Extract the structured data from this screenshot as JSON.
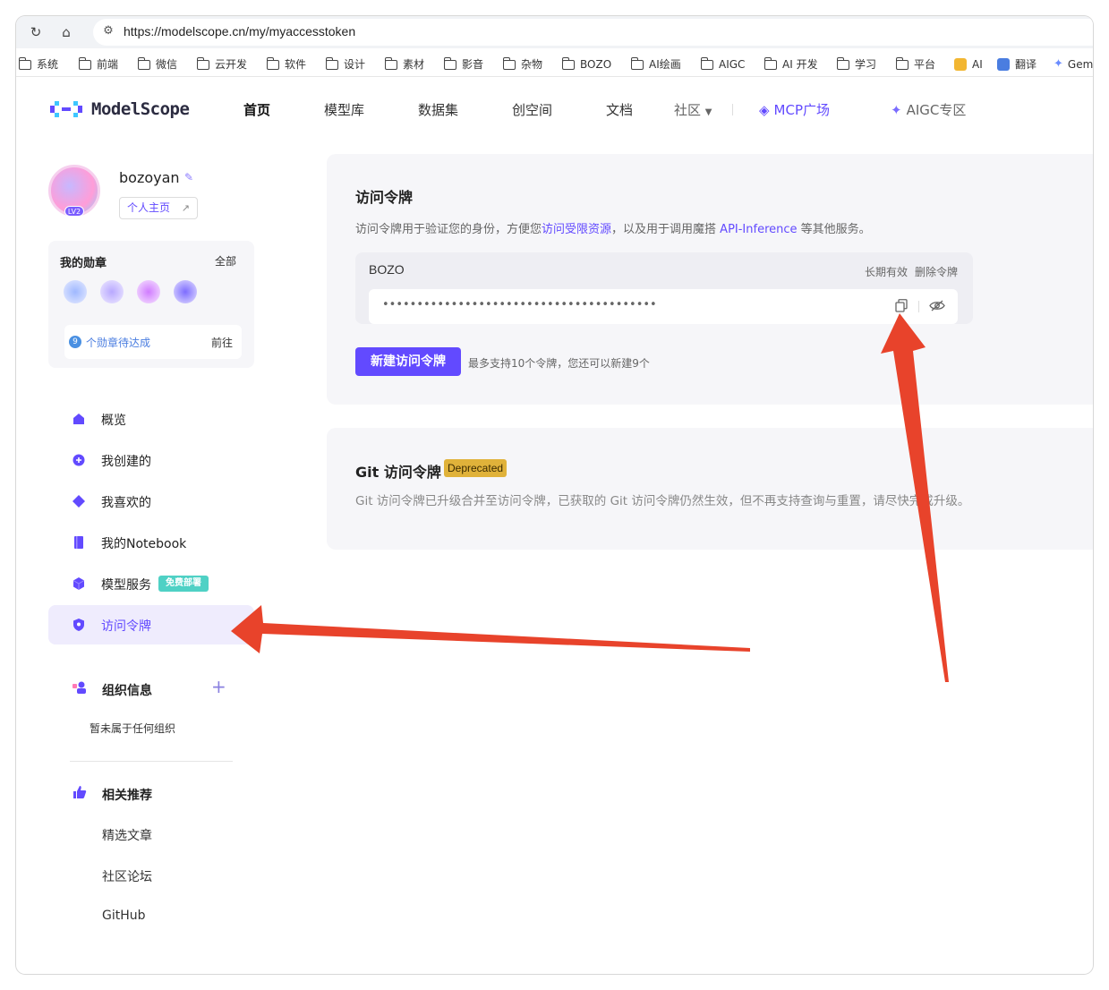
{
  "browser": {
    "url": "https://modelscope.cn/my/myaccesstoken",
    "bookmarks": [
      "系统",
      "前端",
      "微信",
      "云开发",
      "软件",
      "设计",
      "素材",
      "影音",
      "杂物",
      "BOZO",
      "AI绘画",
      "AIGC",
      "AI 开发",
      "学习",
      "平台",
      "AI",
      "翻译",
      "Gem"
    ]
  },
  "header": {
    "logo_text": "ModelScope",
    "nav": [
      "首页",
      "模型库",
      "数据集",
      "创空间",
      "文档",
      "社区",
      "MCP广场",
      "AIGC专区"
    ]
  },
  "profile": {
    "username": "bozoyan",
    "level": "LV2",
    "homepage_label": "个人主页"
  },
  "badges": {
    "title": "我的勋章",
    "all_label": "全部",
    "pending_count": "9",
    "pending_label": "个勋章待达成",
    "goto_label": "前往"
  },
  "menu": {
    "items": [
      "概览",
      "我创建的",
      "我喜欢的",
      "我的Notebook",
      "模型服务",
      "访问令牌"
    ],
    "free_tag": "免费部署",
    "org_title": "组织信息",
    "no_org": "暂未属于任何组织",
    "recommend_title": "相关推荐",
    "links": [
      "精选文章",
      "社区论坛",
      "GitHub"
    ]
  },
  "access_token": {
    "title": "访问令牌",
    "desc_prefix": "访问令牌用于验证您的身份，方便您",
    "desc_link1": "访问受限资源",
    "desc_mid": "，以及用于调用魔搭 ",
    "desc_link2": "API-Inference",
    "desc_suffix": " 等其他服务。",
    "token_name": "BOZO",
    "validity": "长期有效",
    "delete_label": "删除令牌",
    "token_masked": "••••••••••••••••••••••••••••••••••••••••",
    "new_button": "新建访问令牌",
    "limit_hint": "最多支持10个令牌，您还可以新建9个"
  },
  "git_token": {
    "title": "Git 访问令牌",
    "badge": "Deprecated",
    "desc": "Git 访问令牌已升级合并至访问令牌，已获取的 Git 访问令牌仍然生效，但不再支持查询与重置，请尽快完成升级。"
  },
  "colors": {
    "accent": "#624aff",
    "annotation_arrow": "#e8432b",
    "deprecated_bg": "#e0b23a"
  }
}
